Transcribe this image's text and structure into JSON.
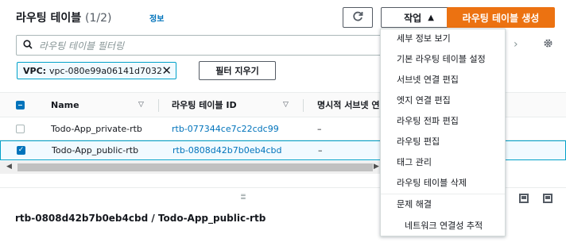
{
  "header": {
    "title": "라우팅 테이블",
    "count": "(1/2)",
    "info": "정보",
    "actions_label": "작업",
    "create_label": "라우팅 테이블 생성"
  },
  "search": {
    "placeholder": "라우팅 테이블 필터링"
  },
  "filter": {
    "key": "VPC:",
    "value": "vpc-080e99a06141d7032",
    "clear_label": "필터 지우기"
  },
  "table": {
    "columns": [
      "Name",
      "라우팅 테이블 ID",
      "명시적 서브넷 연결"
    ],
    "rows": [
      {
        "name": "Todo-App_private-rtb",
        "id": "rtb-077344ce7c22cdc99",
        "explicit": "–",
        "selected": false
      },
      {
        "name": "Todo-App_public-rtb",
        "id": "rtb-0808d42b7b0eb4cbd",
        "explicit": "–",
        "selected": true
      }
    ]
  },
  "detail": {
    "title": "rtb-0808d42b7b0eb4cbd / Todo-App_public-rtb"
  },
  "menu": {
    "items": [
      "세부 정보 보기",
      "기본 라우팅 테이블 설정",
      "서브넷 연결 편집",
      "엣지 연결 편집",
      "라우팅 전파 편집",
      "라우팅 편집",
      "태그 관리",
      "라우팅 테이블 삭제"
    ],
    "group_label": "문제 해결",
    "sub_item": "네트워크 연결성 추적"
  },
  "colors": {
    "primary": "#ec7211",
    "link": "#0073bb",
    "selected_border": "#00a1c9"
  }
}
